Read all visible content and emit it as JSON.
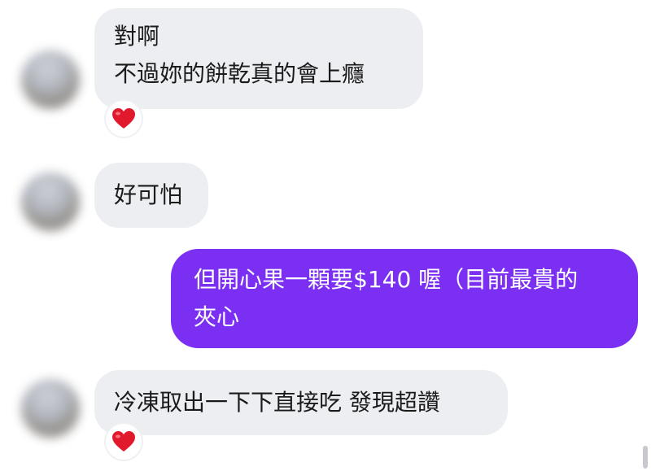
{
  "messages": [
    {
      "direction": "incoming",
      "lines": [
        "對啊",
        "不過妳的餅乾真的會上癮"
      ],
      "reaction": "heart-icon"
    },
    {
      "direction": "incoming",
      "lines": [
        "好可怕"
      ]
    },
    {
      "direction": "outgoing",
      "lines": [
        "但開心果一顆要$140 喔（目前最貴的",
        "夾心"
      ]
    },
    {
      "direction": "incoming",
      "lines": [
        "冷凍取出一下下直接吃 發現超讚"
      ],
      "reaction": "heart-icon"
    }
  ],
  "colors": {
    "incoming_bubble": "#eceef1",
    "outgoing_bubble": "#7b2ff2",
    "reaction_heart": "#e0192d"
  }
}
